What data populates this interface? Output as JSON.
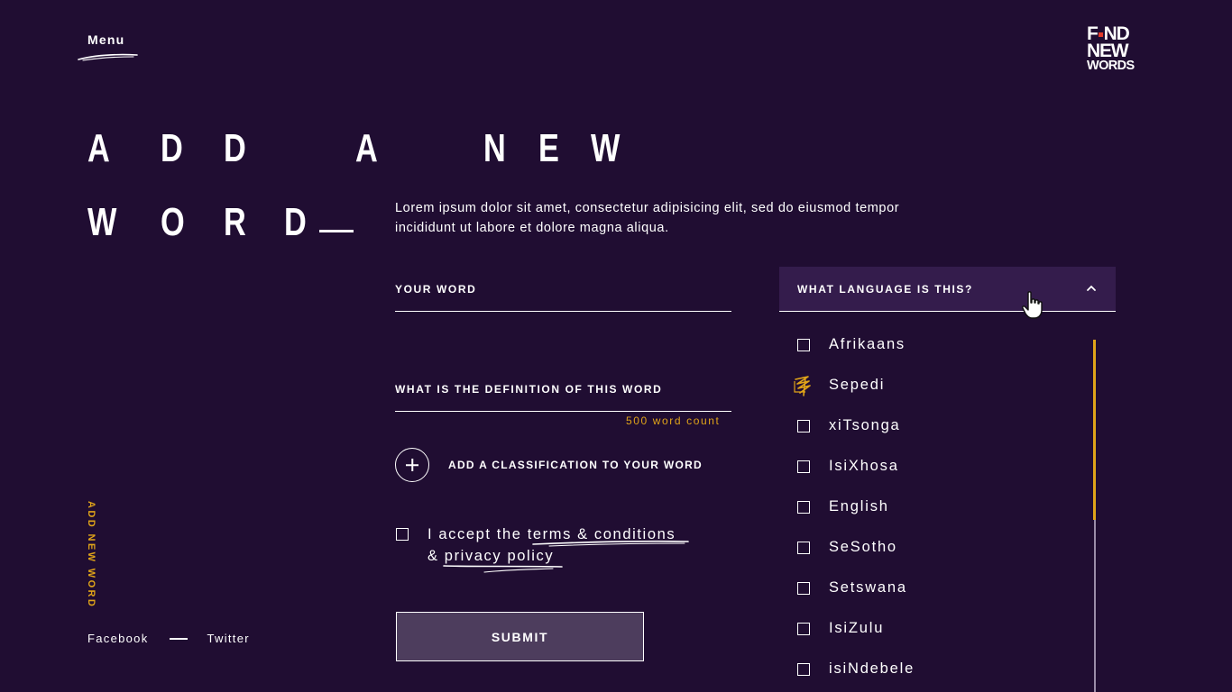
{
  "nav": {
    "menu_label": "Menu"
  },
  "logo": {
    "line1_a": "F",
    "line1_b": "ND",
    "line2": "NEW",
    "line3": "WORDS"
  },
  "title": {
    "line1": [
      "A",
      "D",
      "D",
      "A",
      "N",
      "E",
      "W"
    ],
    "line2": [
      "W",
      "O",
      "R",
      "D"
    ]
  },
  "intro": "Lorem ipsum dolor sit amet, consectetur adipisicing elit, sed do eiusmod tempor incididunt ut labore et dolore magna aliqua.",
  "form": {
    "word_label": "YOUR WORD",
    "definition_label": "WHAT IS THE DEFINITION OF THIS WORD",
    "word_count": "500 word count",
    "classification_label": "ADD A CLASSIFICATION TO YOUR WORD",
    "terms_prefix": "I accept the ",
    "terms_link": "terms & conditions",
    "terms_amp": "& ",
    "privacy_link": "privacy policy",
    "submit_label": "SUBMIT"
  },
  "side_label": "ADD NEW WORD",
  "social": {
    "facebook": "Facebook",
    "twitter": "Twitter"
  },
  "language": {
    "header_label": "WHAT LANGUAGE IS THIS?",
    "options": [
      {
        "label": "Afrikaans",
        "checked": false
      },
      {
        "label": "Sepedi",
        "checked": true
      },
      {
        "label": "xiTsonga",
        "checked": false
      },
      {
        "label": "IsiXhosa",
        "checked": false
      },
      {
        "label": "English",
        "checked": false
      },
      {
        "label": "SeSotho",
        "checked": false
      },
      {
        "label": "Setswana",
        "checked": false
      },
      {
        "label": "IsiZulu",
        "checked": false
      },
      {
        "label": "isiNdebele",
        "checked": false
      }
    ]
  },
  "colors": {
    "background": "#200d32",
    "accent": "#e0a419",
    "dropdown_header": "#341c4c",
    "submit_bg": "#4d3d5d"
  }
}
